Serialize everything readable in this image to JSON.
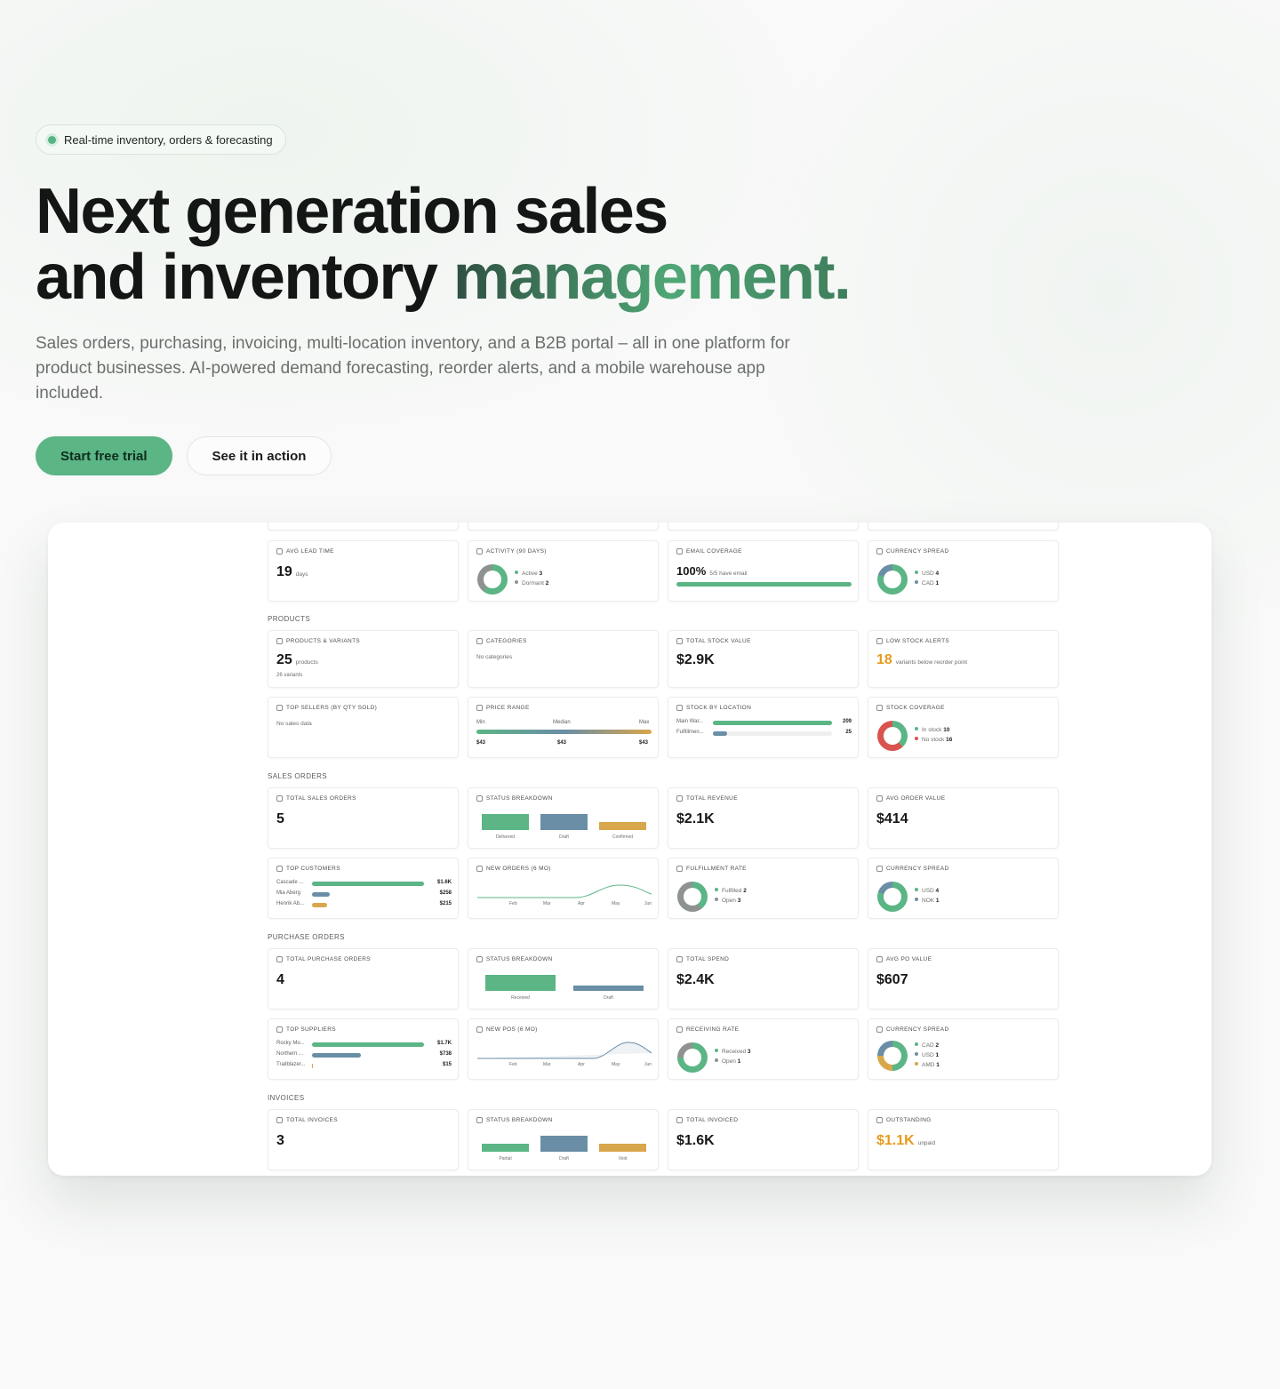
{
  "hero": {
    "badge": "Real-time inventory, orders & forecasting",
    "title_line1": "Next generation sales",
    "title_line2_prefix": "and inventory ",
    "title_line2_accent": "management.",
    "subtitle": "Sales orders, purchasing, invoicing, multi-location inventory, and a B2B portal – all in one platform for product businesses. AI-powered demand forecasting, reorder alerts, and a mobile warehouse app included.",
    "cta_primary": "Start free trial",
    "cta_secondary": "See it in action"
  },
  "colors": {
    "green": "#5bb585",
    "blue": "#6a8ea5",
    "gold": "#d8a64b",
    "red": "#d9534f",
    "orange": "#e79a1e"
  },
  "sections": {
    "products": "PRODUCTS",
    "sales": "SALES ORDERS",
    "purchase": "PURCHASE ORDERS",
    "invoices": "INVOICES"
  },
  "row0": {
    "lead": {
      "title": "AVG LEAD TIME",
      "value": "19",
      "unit": "days",
      "icon": "clock-icon"
    },
    "activity": {
      "title": "ACTIVITY (90 DAYS)",
      "icon": "pulse-icon",
      "legend": [
        {
          "label": "Active",
          "value": "3"
        },
        {
          "label": "Dormant",
          "value": "2"
        }
      ]
    },
    "email": {
      "title": "EMAIL COVERAGE",
      "value": "100%",
      "unit": "5/5 have email",
      "fill": 1.0,
      "icon": "mail-icon"
    },
    "currency": {
      "title": "CURRENCY SPREAD",
      "icon": "currency-icon",
      "legend": [
        {
          "label": "USD",
          "value": "4"
        },
        {
          "label": "CAD",
          "value": "1"
        }
      ]
    }
  },
  "products": {
    "variants": {
      "title": "PRODUCTS & VARIANTS",
      "value": "25",
      "unit": "products",
      "note": "26 variants",
      "icon": "box-icon"
    },
    "categories": {
      "title": "CATEGORIES",
      "note": "No categories",
      "icon": "tag-icon"
    },
    "stock_value": {
      "title": "TOTAL STOCK VALUE",
      "value": "$2.9K",
      "icon": "dollar-icon"
    },
    "low_stock": {
      "title": "LOW STOCK ALERTS",
      "value": "18",
      "unit": "variants below reorder point",
      "icon": "warning-icon"
    },
    "top_sellers": {
      "title": "TOP SELLERS (BY QTY SOLD)",
      "note": "No sales data",
      "icon": "chart-icon"
    },
    "price_range": {
      "title": "PRICE RANGE",
      "labels": [
        "Min",
        "Median",
        "Max"
      ],
      "values": [
        "$43",
        "$43",
        "$43"
      ],
      "icon": "tag-icon"
    },
    "stock_location": {
      "title": "STOCK BY LOCATION",
      "icon": "pin-icon",
      "rows": [
        {
          "label": "Main War...",
          "value": "209",
          "fill": 0.95
        },
        {
          "label": "Fulfillmen...",
          "value": "25",
          "fill": 0.11
        }
      ]
    },
    "coverage": {
      "title": "STOCK COVERAGE",
      "icon": "shield-icon",
      "legend": [
        {
          "label": "In stock",
          "value": "10"
        },
        {
          "label": "No stock",
          "value": "16"
        }
      ]
    }
  },
  "sales": {
    "total": {
      "title": "TOTAL SALES ORDERS",
      "value": "5",
      "icon": "doc-icon"
    },
    "status": {
      "title": "STATUS BREAKDOWN",
      "icon": "clock-icon",
      "bars": [
        {
          "label": "Delivered",
          "value": 2
        },
        {
          "label": "Draft",
          "value": 2
        },
        {
          "label": "Confirmed",
          "value": 1
        }
      ]
    },
    "revenue": {
      "title": "TOTAL REVENUE",
      "value": "$2.1K",
      "icon": "dollar-icon"
    },
    "aov": {
      "title": "AVG ORDER VALUE",
      "value": "$414",
      "icon": "chart-icon"
    },
    "customers": {
      "title": "TOP CUSTOMERS",
      "icon": "users-icon",
      "rows": [
        {
          "label": "Cascade ...",
          "value": "$1.6K",
          "fill": 1.0
        },
        {
          "label": "Mia Aberg",
          "value": "$258",
          "fill": 0.16
        },
        {
          "label": "Henrik Ab...",
          "value": "$215",
          "fill": 0.13
        }
      ]
    },
    "new_orders": {
      "title": "NEW ORDERS (6 MO)",
      "icon": "trend-icon",
      "months": [
        "Feb",
        "Mar",
        "Apr",
        "May",
        "Jun"
      ]
    },
    "fulfillment": {
      "title": "FULFILLMENT RATE",
      "icon": "check-icon",
      "legend": [
        {
          "label": "Fulfilled",
          "value": "2"
        },
        {
          "label": "Open",
          "value": "3"
        }
      ]
    },
    "currency": {
      "title": "CURRENCY SPREAD",
      "icon": "currency-icon",
      "legend": [
        {
          "label": "USD",
          "value": "4"
        },
        {
          "label": "NOK",
          "value": "1"
        }
      ]
    }
  },
  "purchase": {
    "total": {
      "title": "TOTAL PURCHASE ORDERS",
      "value": "4",
      "icon": "doc-icon"
    },
    "status": {
      "title": "STATUS BREAKDOWN",
      "icon": "clock-icon",
      "bars": [
        {
          "label": "Received",
          "value": 3
        },
        {
          "label": "Draft",
          "value": 1
        }
      ]
    },
    "spend": {
      "title": "TOTAL SPEND",
      "value": "$2.4K",
      "icon": "dollar-icon"
    },
    "apo": {
      "title": "AVG PO VALUE",
      "value": "$607",
      "icon": "chart-icon"
    },
    "suppliers": {
      "title": "TOP SUPPLIERS",
      "icon": "truck-icon",
      "rows": [
        {
          "label": "Rocky Mo...",
          "value": "$1.7K",
          "fill": 1.0
        },
        {
          "label": "Northern ...",
          "value": "$738",
          "fill": 0.43
        },
        {
          "label": "Trailblazer...",
          "value": "$15",
          "fill": 0.01
        }
      ]
    },
    "new_pos": {
      "title": "NEW POS (6 MO)",
      "icon": "trend-icon",
      "months": [
        "Feb",
        "Mar",
        "Apr",
        "May",
        "Jun"
      ]
    },
    "receiving": {
      "title": "RECEIVING RATE",
      "icon": "check-icon",
      "legend": [
        {
          "label": "Received",
          "value": "3"
        },
        {
          "label": "Open",
          "value": "1"
        }
      ]
    },
    "currency": {
      "title": "CURRENCY SPREAD",
      "icon": "currency-icon",
      "legend": [
        {
          "label": "CAD",
          "value": "2"
        },
        {
          "label": "USD",
          "value": "1"
        },
        {
          "label": "AMD",
          "value": "1"
        }
      ]
    }
  },
  "invoices": {
    "total": {
      "title": "TOTAL INVOICES",
      "value": "3",
      "icon": "doc-icon"
    },
    "status": {
      "title": "STATUS BREAKDOWN",
      "icon": "clock-icon",
      "bars": [
        {
          "label": "Partial",
          "value": 1
        },
        {
          "label": "Draft",
          "value": 2
        },
        {
          "label": "Void",
          "value": 1
        }
      ]
    },
    "invoiced": {
      "title": "TOTAL INVOICED",
      "value": "$1.6K",
      "icon": "dollar-icon"
    },
    "outstanding": {
      "title": "OUTSTANDING",
      "value": "$1.1K",
      "unit": "unpaid",
      "icon": "clock-icon"
    }
  }
}
